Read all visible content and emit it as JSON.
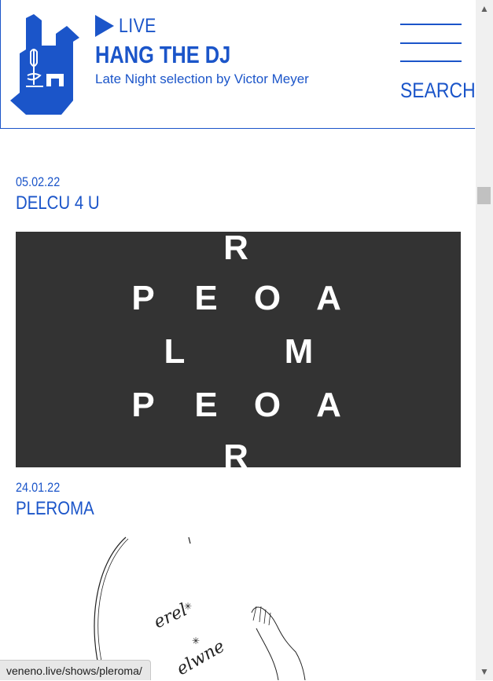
{
  "header": {
    "live_label": "LIVE",
    "show_title": "HANG THE DJ",
    "show_subtitle": "Late Night selection by Victor Meyer",
    "search_label": "SEARCH",
    "brand_color": "#1b55c9"
  },
  "entries": [
    {
      "date": "05.02.22",
      "title": "DELCU 4 U"
    },
    {
      "date": "24.01.22",
      "title": "PLEROMA"
    }
  ],
  "poster": {
    "letters": [
      "R",
      "P",
      "E",
      "O",
      "A",
      "L",
      "M",
      "P",
      "E",
      "O",
      "A",
      "R"
    ]
  },
  "sketch": {
    "words": [
      "erel",
      "elwne"
    ]
  },
  "status_bar": {
    "url": "veneno.live/shows/pleroma/"
  },
  "scrollbar": {
    "up_glyph": "▲",
    "down_glyph": "▼"
  }
}
